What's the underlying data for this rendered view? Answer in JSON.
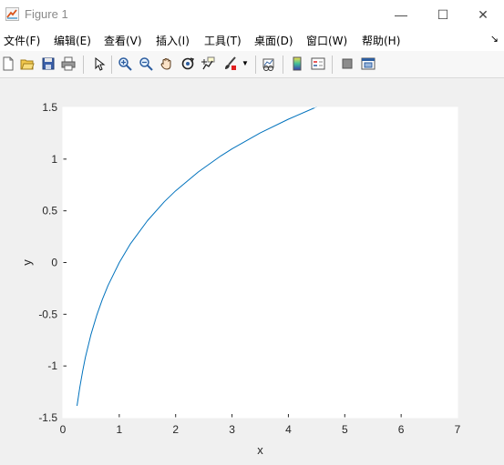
{
  "window": {
    "title": "Figure 1",
    "controls": {
      "minimize": "—",
      "maximize": "☐",
      "close": "✕"
    }
  },
  "menu": {
    "items": [
      {
        "label": "文件(F)"
      },
      {
        "label": "编辑(E)"
      },
      {
        "label": "查看(V)"
      },
      {
        "label": "插入(I)"
      },
      {
        "label": "工具(T)"
      },
      {
        "label": "桌面(D)"
      },
      {
        "label": "窗口(W)"
      },
      {
        "label": "帮助(H)"
      }
    ],
    "overflow": "↘"
  },
  "toolbar": {
    "icons": [
      "new-figure-icon",
      "open-file-icon",
      "save-icon",
      "print-icon",
      "edit-plot-arrow-icon",
      "zoom-in-icon",
      "zoom-out-icon",
      "pan-hand-icon",
      "rotate-3d-icon",
      "data-cursor-icon",
      "brush-icon",
      "link-plot-icon",
      "colorbar-icon",
      "legend-icon",
      "hide-plot-tools-icon",
      "show-plot-tools-icon"
    ]
  },
  "chart_data": {
    "type": "line",
    "title": "",
    "xlabel": "x",
    "ylabel": "y",
    "xlim": [
      0,
      7
    ],
    "ylim": [
      -1.5,
      1.5
    ],
    "xticks": [
      "0",
      "1",
      "2",
      "3",
      "4",
      "5",
      "6",
      "7"
    ],
    "yticks": [
      "1.5",
      "1",
      "0.5",
      "0",
      "-0.5",
      "-1",
      "-1.5"
    ],
    "grid": false,
    "series": [
      {
        "color": "#0072bd",
        "x": [
          0.25,
          0.3,
          0.35,
          0.4,
          0.5,
          0.6,
          0.7,
          0.8,
          1.0,
          1.2,
          1.5,
          1.8,
          2.0,
          2.4,
          2.8,
          3.0,
          3.5,
          4.0,
          4.5
        ],
        "y": [
          -1.386,
          -1.204,
          -1.05,
          -0.916,
          -0.693,
          -0.511,
          -0.357,
          -0.223,
          0.0,
          0.182,
          0.405,
          0.588,
          0.693,
          0.875,
          1.03,
          1.099,
          1.253,
          1.386,
          1.504
        ]
      }
    ]
  }
}
